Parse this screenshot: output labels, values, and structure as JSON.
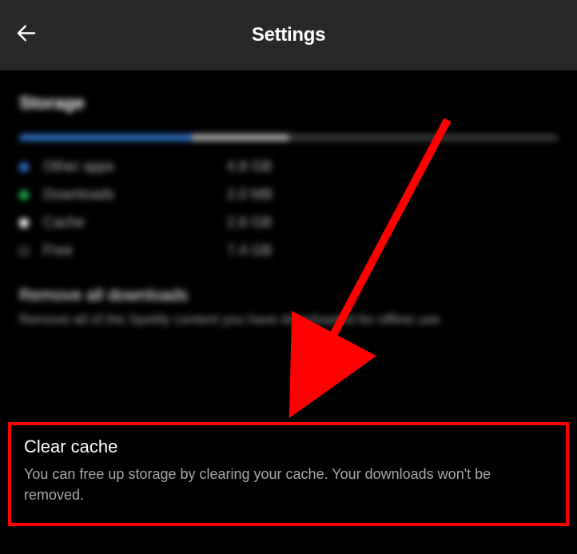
{
  "header": {
    "title": "Settings"
  },
  "storage": {
    "section_title": "Storage",
    "segments": [
      {
        "color": "blue",
        "pct": 32
      },
      {
        "color": "gray",
        "pct": 18
      },
      {
        "color": "dark",
        "pct": 50
      }
    ],
    "legend": [
      {
        "dot": "blue",
        "label": "Other apps",
        "value": "4.8 GB"
      },
      {
        "dot": "green",
        "label": "Downloads",
        "value": "2.0 MB"
      },
      {
        "dot": "white",
        "label": "Cache",
        "value": "2.6 GB"
      },
      {
        "dot": "outline",
        "label": "Free",
        "value": "7.4 GB"
      }
    ]
  },
  "remove_downloads": {
    "title": "Remove all downloads",
    "desc": "Remove all of the Spotify content you have downloaded for offline use."
  },
  "clear_cache": {
    "title": "Clear cache",
    "desc": "You can free up storage by clearing your cache. Your downloads won't be removed."
  },
  "annotation": {
    "highlight_color": "#ff0000"
  }
}
